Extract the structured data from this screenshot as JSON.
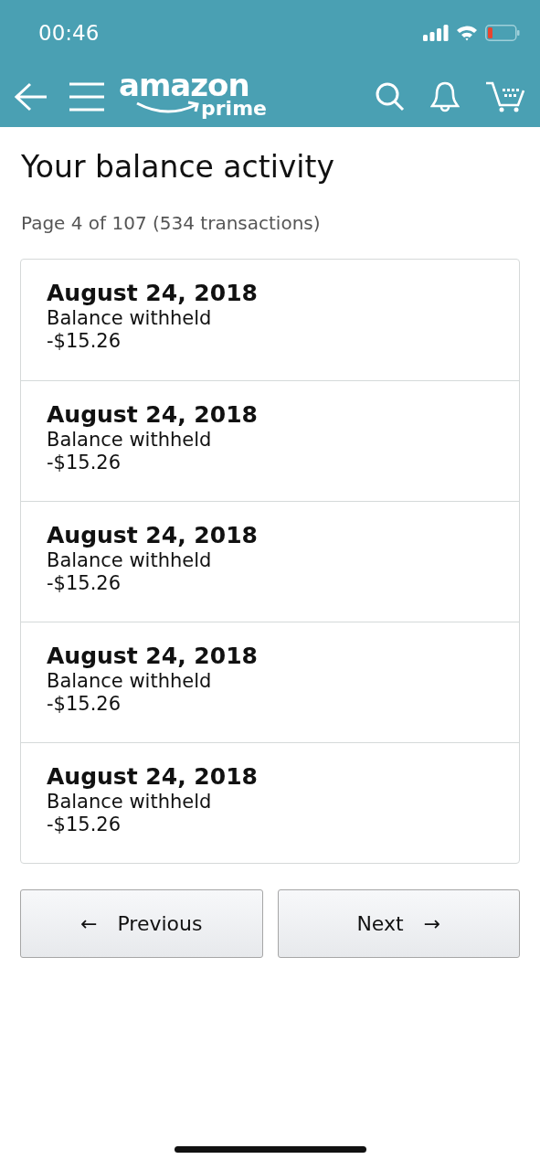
{
  "status_bar": {
    "time": "00:46"
  },
  "header": {
    "logo": "amazon",
    "logo_sub": "prime"
  },
  "title": "Your balance activity",
  "page_info": "Page 4 of 107 (534 transactions)",
  "transactions": [
    {
      "date": "August 24, 2018",
      "description": "Balance withheld",
      "amount": "-$15.26"
    },
    {
      "date": "August 24, 2018",
      "description": "Balance withheld",
      "amount": "-$15.26"
    },
    {
      "date": "August 24, 2018",
      "description": "Balance withheld",
      "amount": "-$15.26"
    },
    {
      "date": "August 24, 2018",
      "description": "Balance withheld",
      "amount": "-$15.26"
    },
    {
      "date": "August 24, 2018",
      "description": "Balance withheld",
      "amount": "-$15.26"
    }
  ],
  "pagination": {
    "previous": {
      "arrow": "←",
      "label": "Previous"
    },
    "next": {
      "label": "Next",
      "arrow": "→"
    }
  }
}
